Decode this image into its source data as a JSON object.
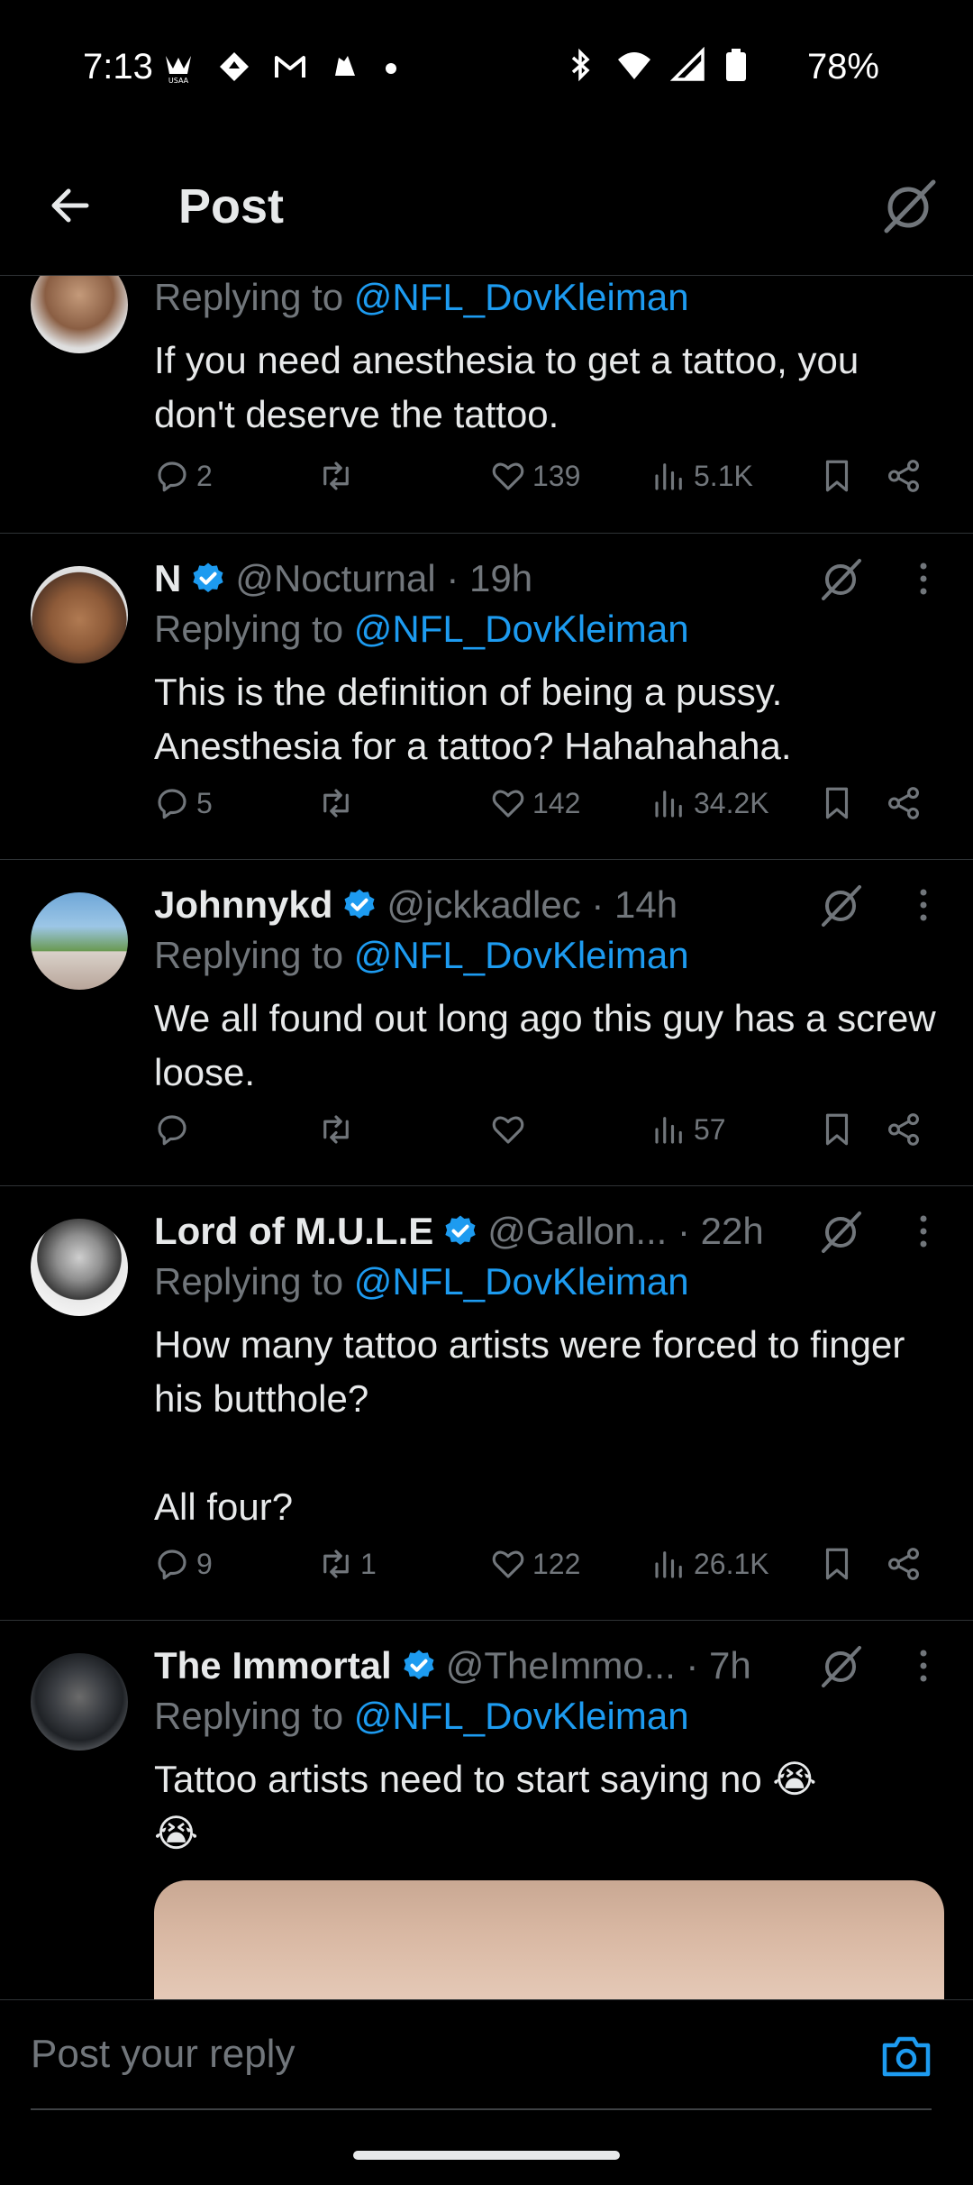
{
  "status_bar": {
    "time": "7:13",
    "battery": "78%",
    "left_icons": [
      "usaa-icon",
      "navigation-icon",
      "gmail-icon",
      "messaging-icon",
      "dot-icon"
    ],
    "right_icons": [
      "bluetooth-icon",
      "wifi-icon",
      "signal-icon",
      "battery-icon"
    ]
  },
  "header": {
    "title": "Post"
  },
  "colors": {
    "accent": "#1d9bf0",
    "muted": "#71767b",
    "text": "#e7e9ea",
    "divider": "#2f3336"
  },
  "posts": [
    {
      "name": "",
      "handle": "",
      "time": "",
      "replying_prefix": "Replying to ",
      "replying_to": "@NFL_DovKleiman",
      "text": "If you need anesthesia to get a tattoo, you don't deserve the tattoo.",
      "replies": "2",
      "reposts": "",
      "likes": "139",
      "views": "5.1K"
    },
    {
      "name": "N",
      "handle": "@Nocturnal",
      "time": "· 19h",
      "replying_prefix": "Replying to ",
      "replying_to": "@NFL_DovKleiman",
      "text": "This is the definition of being a pussy. Anesthesia for a tattoo? Hahahahaha.",
      "replies": "5",
      "reposts": "",
      "likes": "142",
      "views": "34.2K"
    },
    {
      "name": "Johnnykd",
      "handle": "@jckkadlec",
      "time": "· 14h",
      "replying_prefix": "Replying to ",
      "replying_to": "@NFL_DovKleiman",
      "text": "We all found out long ago this guy has a screw loose.",
      "replies": "",
      "reposts": "",
      "likes": "",
      "views": "57"
    },
    {
      "name": "Lord of M.U.L.E",
      "handle": "@Gallon...",
      "time": "· 22h",
      "replying_prefix": "Replying to ",
      "replying_to": "@NFL_DovKleiman",
      "text": "How many tattoo artists were forced to finger his butthole?\n\nAll four?",
      "replies": "9",
      "reposts": "1",
      "likes": "122",
      "views": "26.1K"
    },
    {
      "name": "The Immortal",
      "handle": "@TheImmo...",
      "time": "· 7h",
      "replying_prefix": "Replying to ",
      "replying_to": "@NFL_DovKleiman",
      "text": "Tattoo artists need to start saying no 😭\n😭"
    }
  ],
  "reply_bar": {
    "placeholder": "Post your reply"
  }
}
